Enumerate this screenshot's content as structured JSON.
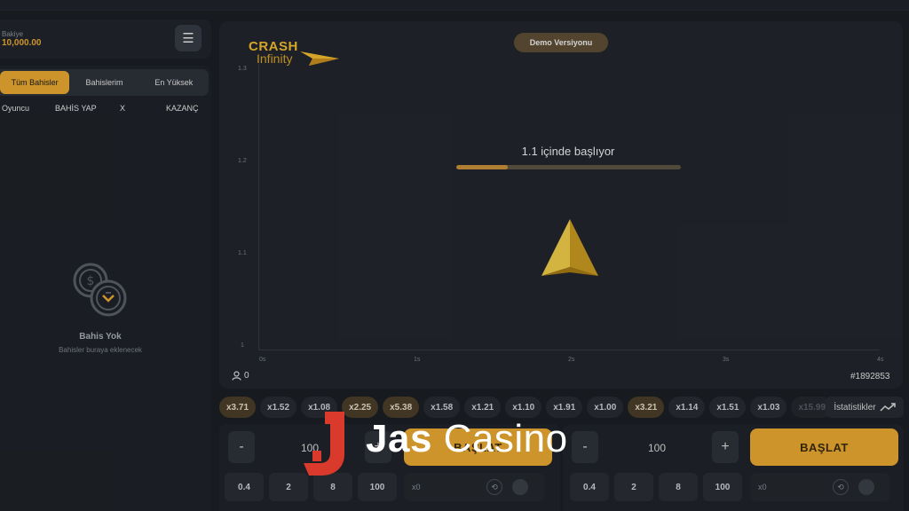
{
  "sidebar": {
    "balance_label": "Bakiye",
    "balance_value": "10,000.00",
    "tabs": [
      {
        "label": "Tüm Bahisler",
        "active": true
      },
      {
        "label": "Bahislerim",
        "active": false
      },
      {
        "label": "En Yüksek",
        "active": false
      }
    ],
    "columns": [
      "Oyuncu",
      "BAHİS YAP",
      "X",
      "KAZANÇ"
    ],
    "empty_title": "Bahis Yok",
    "empty_subtitle": "Bahisler buraya eklenecek"
  },
  "game": {
    "logo_line1": "CRASH",
    "logo_line2": "Infinity",
    "demo_label": "Demo Versiyonu",
    "countdown_text": "1.1 içinde başlıyor",
    "countdown_progress": 0.23,
    "y_ticks": [
      "1.3",
      "1.2",
      "1.1",
      "1"
    ],
    "x_ticks": [
      "0s",
      "1s",
      "2s",
      "3s",
      "4s"
    ],
    "players_count": "0",
    "round_id": "#1892853"
  },
  "history": [
    {
      "value": "x3.71",
      "highlight": true
    },
    {
      "value": "x1.52",
      "highlight": false
    },
    {
      "value": "x1.08",
      "highlight": false
    },
    {
      "value": "x2.25",
      "highlight": true
    },
    {
      "value": "x5.38",
      "highlight": true
    },
    {
      "value": "x1.58",
      "highlight": false
    },
    {
      "value": "x1.21",
      "highlight": false
    },
    {
      "value": "x1.10",
      "highlight": false
    },
    {
      "value": "x1.91",
      "highlight": false
    },
    {
      "value": "x1.00",
      "highlight": false
    },
    {
      "value": "x3.21",
      "highlight": true
    },
    {
      "value": "x1.14",
      "highlight": false
    },
    {
      "value": "x1.51",
      "highlight": false
    },
    {
      "value": "x1.03",
      "highlight": false
    },
    {
      "value": "x15.99",
      "highlight": true
    }
  ],
  "stats_label": "İstatistikler",
  "bet_panels": [
    {
      "minus": "-",
      "amount": "100",
      "plus": "+",
      "start_label": "BAŞLAT",
      "presets": [
        "0.4",
        "2",
        "8",
        "100"
      ],
      "auto_label": "x0"
    },
    {
      "minus": "-",
      "amount": "100",
      "plus": "+",
      "start_label": "BAŞLAT",
      "presets": [
        "0.4",
        "2",
        "8",
        "100"
      ],
      "auto_label": "x0"
    }
  ],
  "watermark": {
    "brand_bold": "Jas",
    "brand_thin": "Casino"
  },
  "colors": {
    "accent": "#e9a930",
    "bg": "#1b1e24",
    "panel": "#22262d",
    "watermark_red": "#d93a2b"
  }
}
